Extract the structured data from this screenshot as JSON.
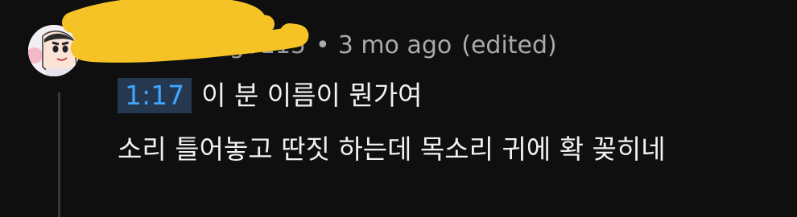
{
  "comment": {
    "author": "g0115",
    "separator": "•",
    "time": "3 mo ago",
    "edited": "(edited)",
    "timestamp": "1:17",
    "line1": "이 분 이름이 뭔가여",
    "line2": "소리 틀어놓고 딴짓 하는데 목소리 귀에 확 꽂히네"
  },
  "colors": {
    "background": "#0f0f0f",
    "link": "#3ea6ff",
    "link_bg": "#263850",
    "scribble": "#f5c326"
  },
  "icons": {
    "avatar": "cartoon-character-avatar"
  }
}
